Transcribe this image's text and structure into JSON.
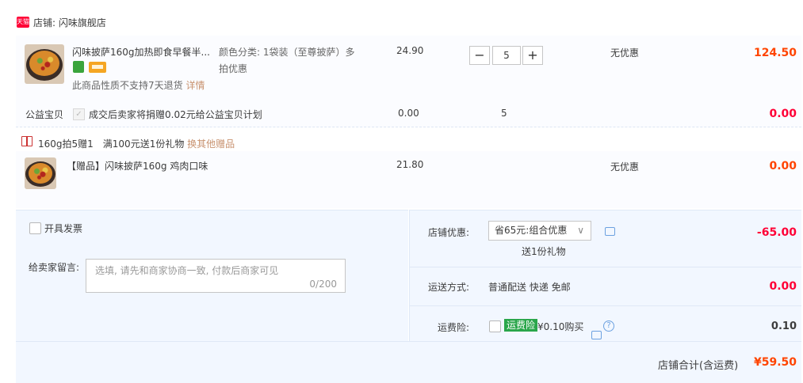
{
  "store": {
    "tag": "天猫",
    "name": "店铺: 闪味旗舰店"
  },
  "item": {
    "title": "闪味披萨160g加热即食早餐半...",
    "spec": "颜色分类: 1袋装（至尊披萨）多",
    "spec2": "拍优惠",
    "unit_price": "24.90",
    "quantity": "5",
    "discount": "无优惠",
    "subtotal": "124.50",
    "return_note": "此商品性质不支持7天退货",
    "detail_link": "详情",
    "minus_label": "−",
    "plus_label": "+"
  },
  "charity": {
    "label": "公益宝贝",
    "text": "成交后卖家将捐赠0.02元给公益宝贝计划",
    "price": "0.00",
    "qty": "5",
    "subtotal": "0.00"
  },
  "gift_promo": {
    "text": "160g拍5赠1　满100元送1份礼物",
    "link": "换其他赠品"
  },
  "gift_item": {
    "title": "【赠品】闪味披萨160g 鸡肉口味",
    "price": "21.80",
    "discount": "无优惠",
    "subtotal": "0.00"
  },
  "invoice": {
    "label": "开具发票"
  },
  "message": {
    "label": "给卖家留言:",
    "placeholder": "选填, 请先和商家协商一致, 付款后商家可见",
    "counter": "0/200"
  },
  "store_discount": {
    "label": "店铺优惠:",
    "selected": "省65元:组合优惠",
    "sub": "送1份礼物",
    "amount": "-65.00"
  },
  "shipping": {
    "label": "运送方式:",
    "value": "普通配送 快递 免邮",
    "amount": "0.00"
  },
  "insurance": {
    "label": "运费险:",
    "tag": "运费险",
    "text": "¥0.10购买",
    "amount": "0.10",
    "help": "?"
  },
  "total": {
    "label": "店铺合计(含运费)",
    "amount": "¥59.50"
  },
  "colors": {
    "red": "#ff0036",
    "orange": "#ff4400",
    "green": "#2aa64b",
    "link": "#c8926f",
    "panel": "#f2f7ff"
  }
}
